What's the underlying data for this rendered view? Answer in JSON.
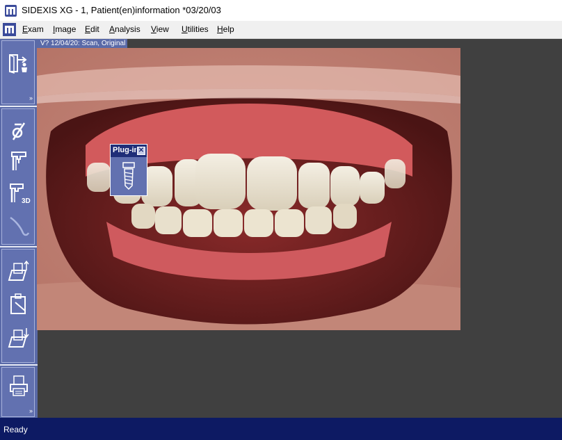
{
  "window": {
    "title": "SIDEXIS XG - 1, Patient(en)information *03/20/03"
  },
  "menu": {
    "items": [
      {
        "label": "Exam",
        "underline": "E",
        "rest": "xam"
      },
      {
        "label": "Image",
        "underline": "I",
        "rest": "mage"
      },
      {
        "label": "Edit",
        "underline": "E",
        "rest": "dit"
      },
      {
        "label": "Analysis",
        "underline": "A",
        "rest": "nalysis"
      },
      {
        "label": "View",
        "underline": "V",
        "rest": "iew"
      },
      {
        "label": "Utilities",
        "underline": "U",
        "rest": "tilities"
      },
      {
        "label": "Help",
        "underline": "H",
        "rest": "elp"
      }
    ]
  },
  "sidebar": {
    "icons": [
      "patient-exit-icon",
      "no-xray-icon",
      "xray-unit-icon",
      "xray-3d-icon",
      "intraoral-camera-icon",
      "export-image-icon",
      "clipboard-icon",
      "import-image-icon",
      "print-icon"
    ],
    "badge_3d": "3D",
    "more_glyph": "»"
  },
  "image_view": {
    "header": "V? 12/04/20: Scan, Original"
  },
  "plugin_panel": {
    "title": "Plug-in",
    "close_glyph": "✕",
    "icon": "implant-icon"
  },
  "status": {
    "text": "Ready"
  },
  "colors": {
    "sidebar": "#5a6aa8",
    "statusbar": "#0d1a63",
    "workspace": "#404040",
    "plugin_header": "#1f2e78"
  }
}
